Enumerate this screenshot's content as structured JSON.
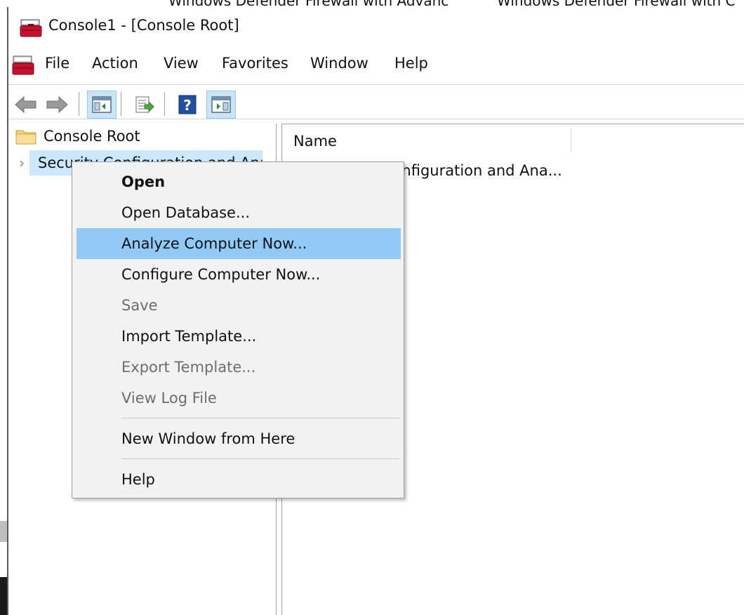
{
  "window": {
    "title": "Console1 - [Console Root]",
    "icon": "mmc-toolbox-icon"
  },
  "background": {
    "top_text_1": "Windows Defender Firewall with Advanc",
    "top_text_2": "Windows Defender Firewall with C"
  },
  "menubar": {
    "items": [
      "File",
      "Action",
      "View",
      "Favorites",
      "Window",
      "Help"
    ]
  },
  "toolbar": {
    "buttons": [
      "back-icon",
      "forward-icon",
      "show-hide-console-tree-icon",
      "export-list-icon",
      "help-icon",
      "show-hide-action-pane-icon"
    ]
  },
  "tree": {
    "root_label": "Console Root",
    "child_label": "Security Configuration and Analysis"
  },
  "list": {
    "column_name": "Name",
    "row_label": "Security Configuration and Ana..."
  },
  "context_menu": {
    "items": [
      {
        "label": "Open",
        "state": "default"
      },
      {
        "label": "Open Database...",
        "state": "normal"
      },
      {
        "label": "Analyze Computer Now...",
        "state": "hover"
      },
      {
        "label": "Configure Computer Now...",
        "state": "normal"
      },
      {
        "label": "Save",
        "state": "disabled"
      },
      {
        "label": "Import Template...",
        "state": "normal"
      },
      {
        "label": "Export Template...",
        "state": "disabled"
      },
      {
        "label": "View Log File",
        "state": "disabled"
      },
      {
        "label": "New Window from Here",
        "state": "normal"
      },
      {
        "label": "Help",
        "state": "normal"
      }
    ]
  },
  "colors": {
    "menu_hover": "#91c9f7",
    "tree_selection": "#cce8ff",
    "toolbar_active": "#cce4f7",
    "disabled_text": "#6d6d6d"
  }
}
